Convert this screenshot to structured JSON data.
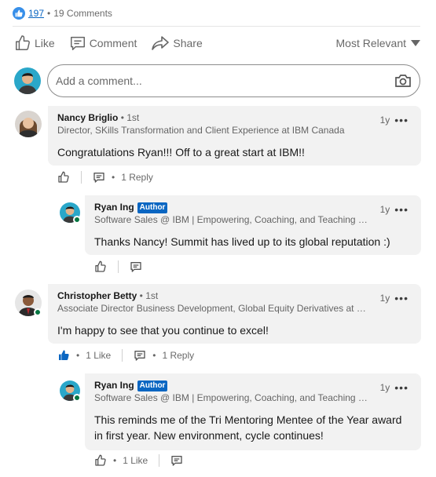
{
  "social": {
    "reaction_count": "197",
    "separator": "•",
    "comment_count": "19 Comments"
  },
  "actions": {
    "like": "Like",
    "comment": "Comment",
    "share": "Share",
    "sort": "Most Relevant"
  },
  "composer": {
    "placeholder": "Add a comment..."
  },
  "comments": [
    {
      "name": "Nancy Briglio",
      "degree": " • 1st",
      "headline": "Director, SKills Transformation and Client Experience at IBM Canada",
      "time": "1y",
      "text": "Congratulations Ryan!!! Off to a great start at IBM!!",
      "likes": "",
      "replies": "1 Reply"
    },
    {
      "name": "Ryan Ing",
      "badge": "Author",
      "headline": "Software Sales @ IBM | Empowering, Coaching, and Teaching Ot...",
      "time": "1y",
      "text": "Thanks Nancy! Summit has lived up to its global reputation :)"
    },
    {
      "name": "Christopher Betty",
      "degree": " • 1st",
      "headline": "Associate Director Business Development, Global Equity Derivatives at Sco...",
      "time": "1y",
      "text": "I'm happy to see that you continue to excel!",
      "likes": "1 Like",
      "replies": "1 Reply"
    },
    {
      "name": "Ryan Ing",
      "badge": "Author",
      "headline": "Software Sales @ IBM | Empowering, Coaching, and Teaching Ot...",
      "time": "1y",
      "text": "This reminds me of the Tri Mentoring Mentee of the Year award in first year. New environment, cycle continues!",
      "likes": "1 Like"
    }
  ],
  "misc": {
    "bullet": "•",
    "dots": "•••"
  },
  "colors": {
    "brand_blue": "#0a66c2",
    "reaction_blue": "#378fe9",
    "bubble_bg": "#f2f2f2",
    "online_green": "#057642"
  },
  "icons": [
    "like-reaction-icon",
    "thumbs-up-icon",
    "comment-icon",
    "share-icon",
    "chevron-down-icon",
    "camera-icon",
    "more-options-icon"
  ]
}
